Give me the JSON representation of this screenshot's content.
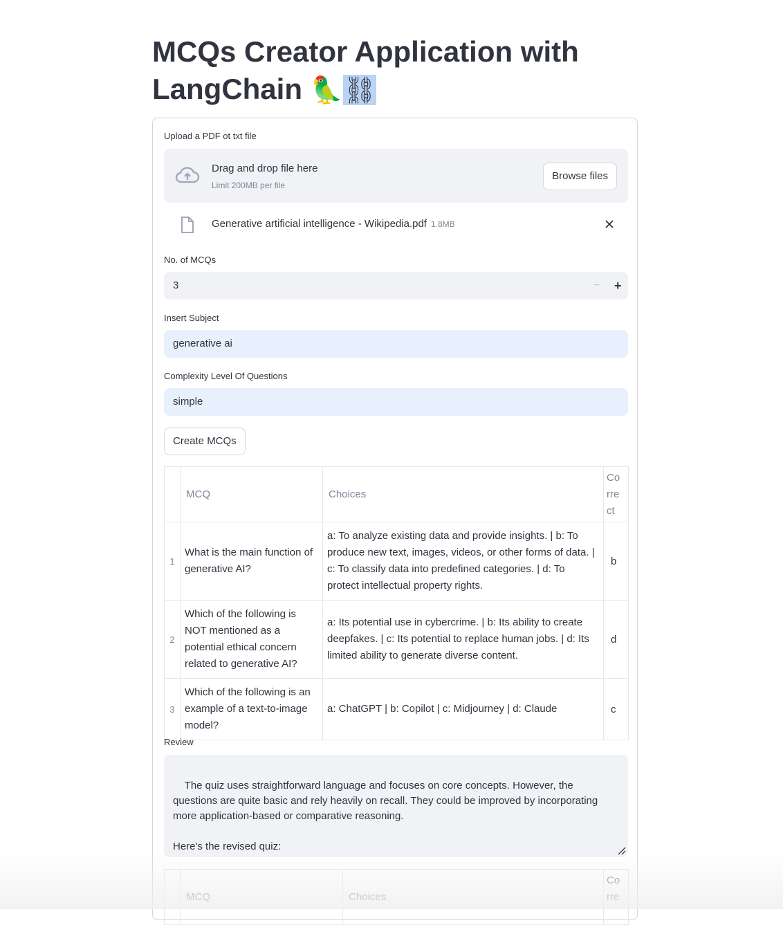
{
  "title": {
    "line1": "MCQs Creator Application with",
    "line2": "LangChain",
    "emoji1": "🦜",
    "emoji2": "⛓"
  },
  "upload": {
    "label": "Upload a PDF ot txt file",
    "drag_text": "Drag and drop file here",
    "limit_text": "Limit 200MB per file",
    "browse_label": "Browse files",
    "file_name": "Generative artificial intelligence - Wikipedia.pdf",
    "file_size": "1.8MB"
  },
  "num_mcqs": {
    "label": "No. of MCQs",
    "value": "3",
    "minus": "−",
    "plus": "+"
  },
  "subject": {
    "label": "Insert Subject",
    "value": "generative ai"
  },
  "complexity": {
    "label": "Complexity Level Of Questions",
    "value": "simple"
  },
  "create_button": "Create MCQs",
  "table": {
    "headers": {
      "mcq": "MCQ",
      "choices": "Choices",
      "correct": "Correct",
      "correct_wrapped": "Co\nrre\nct"
    },
    "rows": [
      {
        "index": "1",
        "mcq": "What is the main function of generative AI?",
        "choices": "a: To analyze existing data and provide insights. | b: To produce new text, images, videos, or other forms of data. | c: To classify data into predefined categories. | d: To protect intellectual property rights.",
        "correct": "b"
      },
      {
        "index": "2",
        "mcq": "Which of the following is NOT mentioned as a potential ethical concern related to generative AI?",
        "choices": "a: Its potential use in cybercrime. | b: Its ability to create deepfakes. | c: Its potential to replace human jobs. | d: Its limited ability to generate diverse content.",
        "correct": "d"
      },
      {
        "index": "3",
        "mcq": "Which of the following is an example of a text-to-image model?",
        "choices": "a: ChatGPT | b: Copilot | c: Midjourney | d: Claude",
        "correct": "c"
      }
    ]
  },
  "review": {
    "label": "Review",
    "text": "The quiz uses straightforward language and focuses on core concepts. However, the questions are quite basic and rely heavily on recall. They could be improved by incorporating more application-based or comparative reasoning.\n\nHere's the revised quiz:"
  },
  "table2": {
    "headers": {
      "mcq": "MCQ",
      "choices": "Choices",
      "correct_wrapped": "Co\nrre"
    }
  }
}
